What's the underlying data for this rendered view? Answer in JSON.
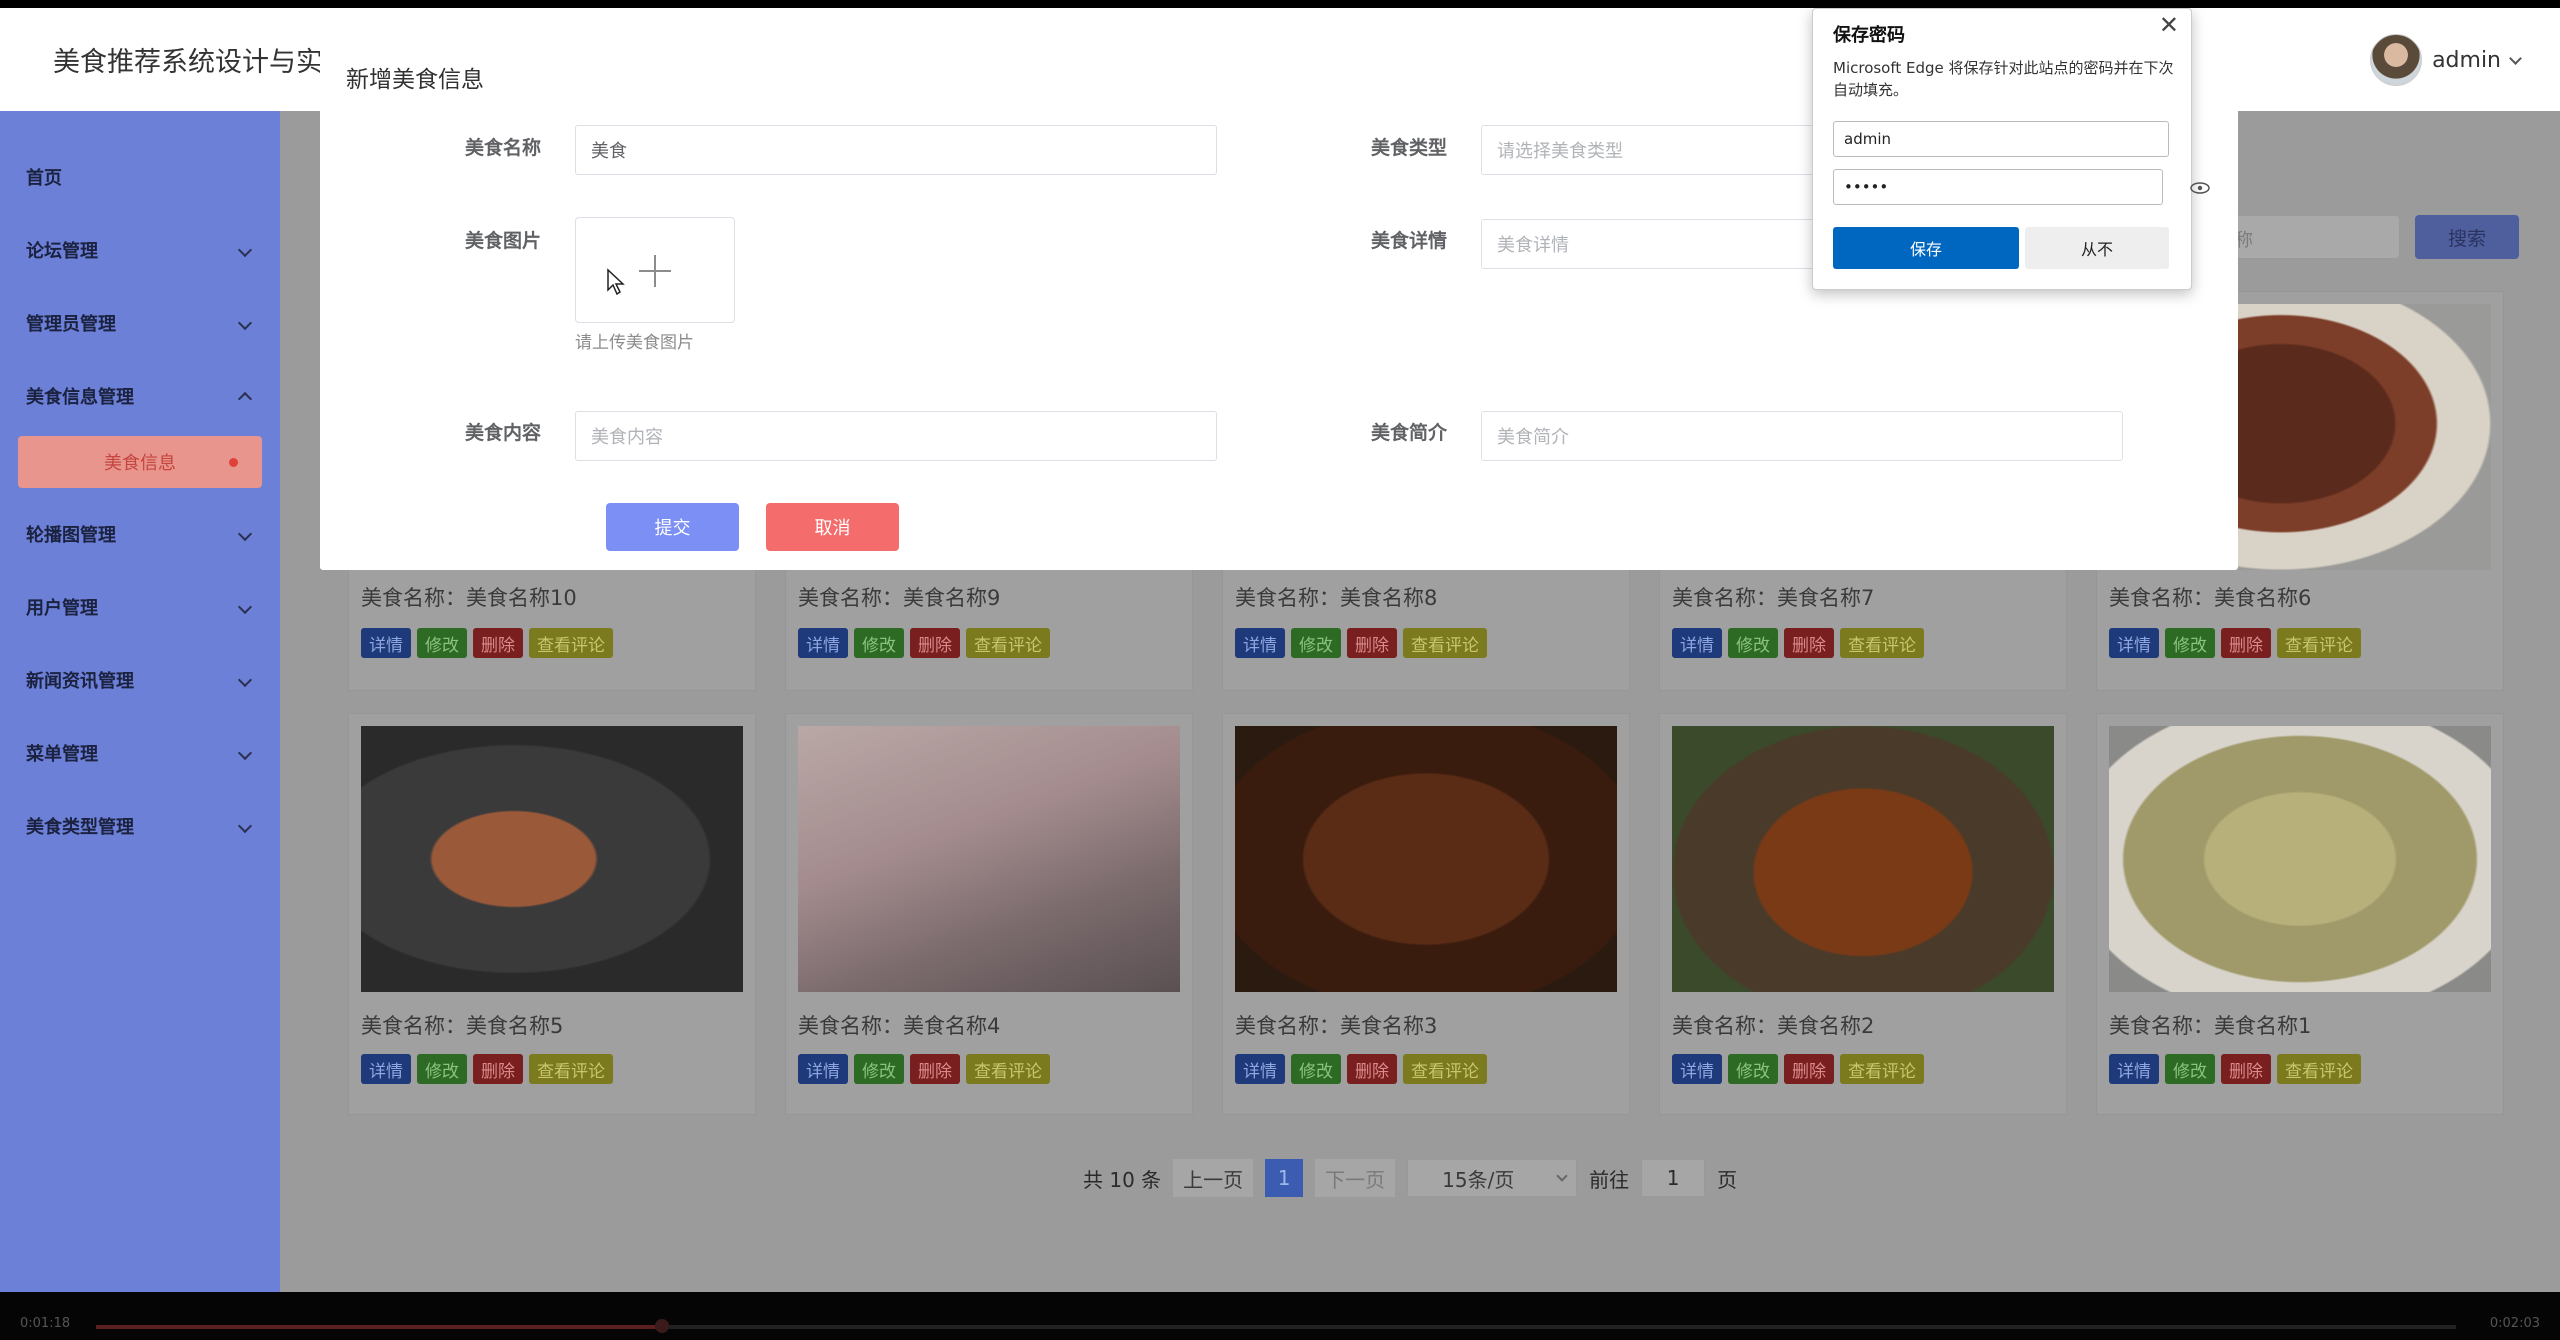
{
  "header": {
    "app_title": "美食推荐系统设计与实",
    "user": "admin"
  },
  "sidebar": {
    "items": [
      {
        "label": "首页"
      },
      {
        "label": "论坛管理"
      },
      {
        "label": "管理员管理"
      },
      {
        "label": "美食信息管理"
      },
      {
        "label": "轮播图管理"
      },
      {
        "label": "用户管理"
      },
      {
        "label": "新闻资讯管理"
      },
      {
        "label": "菜单管理"
      },
      {
        "label": "美食类型管理"
      }
    ],
    "active_sub": "美食信息"
  },
  "search": {
    "placeholder": "名称",
    "button": "搜索"
  },
  "card_actions": {
    "detail": "详情",
    "edit": "修改",
    "delete": "删除",
    "comment": "查看评论"
  },
  "cards": [
    {
      "name": "美食名称：美食名称10"
    },
    {
      "name": "美食名称：美食名称9"
    },
    {
      "name": "美食名称：美食名称8"
    },
    {
      "name": "美食名称：美食名称7"
    },
    {
      "name": "美食名称：美食名称6"
    },
    {
      "name": "美食名称：美食名称5"
    },
    {
      "name": "美食名称：美食名称4"
    },
    {
      "name": "美食名称：美食名称3"
    },
    {
      "name": "美食名称：美食名称2"
    },
    {
      "name": "美食名称：美食名称1"
    }
  ],
  "pagination": {
    "total": "共 10 条",
    "prev": "上一页",
    "current": "1",
    "next": "下一页",
    "page_size": "15条/页",
    "goto": "前往",
    "goto_value": "1",
    "page_suffix": "页"
  },
  "dialog": {
    "title": "新增美食信息",
    "name_label": "美食名称",
    "name_value": "美食",
    "type_label": "美食类型",
    "type_placeholder": "请选择美食类型",
    "image_label": "美食图片",
    "upload_tip": "请上传美食图片",
    "detail_label": "美食详情",
    "detail_placeholder": "美食详情",
    "content_label": "美食内容",
    "content_placeholder": "美食内容",
    "intro_label": "美食简介",
    "intro_placeholder": "美食简介",
    "submit": "提交",
    "cancel": "取消"
  },
  "edge_popup": {
    "title": "保存密码",
    "description": "Microsoft Edge 将保存针对此站点的密码并在下次自动填充。",
    "username": "admin",
    "password": "•••••",
    "save": "保存",
    "never": "从不"
  },
  "video": {
    "elapsed": "0:01:18",
    "duration": "0:02:03",
    "progress": 0.24
  },
  "colors": {
    "sidebar": "#6d80d8",
    "primary_button": "#7c8ff5",
    "danger_button": "#f56c6c",
    "edge_blue": "#0067c0"
  }
}
